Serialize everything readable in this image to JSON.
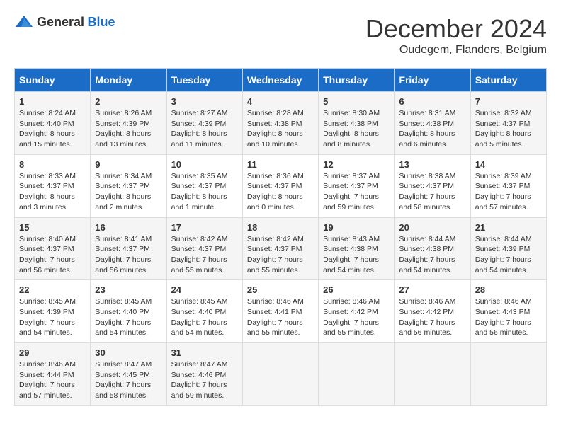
{
  "header": {
    "logo_general": "General",
    "logo_blue": "Blue",
    "month_title": "December 2024",
    "location": "Oudegem, Flanders, Belgium"
  },
  "days_of_week": [
    "Sunday",
    "Monday",
    "Tuesday",
    "Wednesday",
    "Thursday",
    "Friday",
    "Saturday"
  ],
  "weeks": [
    [
      {
        "day": "1",
        "sunrise": "8:24 AM",
        "sunset": "4:40 PM",
        "daylight": "8 hours and 15 minutes."
      },
      {
        "day": "2",
        "sunrise": "8:26 AM",
        "sunset": "4:39 PM",
        "daylight": "8 hours and 13 minutes."
      },
      {
        "day": "3",
        "sunrise": "8:27 AM",
        "sunset": "4:39 PM",
        "daylight": "8 hours and 11 minutes."
      },
      {
        "day": "4",
        "sunrise": "8:28 AM",
        "sunset": "4:38 PM",
        "daylight": "8 hours and 10 minutes."
      },
      {
        "day": "5",
        "sunrise": "8:30 AM",
        "sunset": "4:38 PM",
        "daylight": "8 hours and 8 minutes."
      },
      {
        "day": "6",
        "sunrise": "8:31 AM",
        "sunset": "4:38 PM",
        "daylight": "8 hours and 6 minutes."
      },
      {
        "day": "7",
        "sunrise": "8:32 AM",
        "sunset": "4:37 PM",
        "daylight": "8 hours and 5 minutes."
      }
    ],
    [
      {
        "day": "8",
        "sunrise": "8:33 AM",
        "sunset": "4:37 PM",
        "daylight": "8 hours and 3 minutes."
      },
      {
        "day": "9",
        "sunrise": "8:34 AM",
        "sunset": "4:37 PM",
        "daylight": "8 hours and 2 minutes."
      },
      {
        "day": "10",
        "sunrise": "8:35 AM",
        "sunset": "4:37 PM",
        "daylight": "8 hours and 1 minute."
      },
      {
        "day": "11",
        "sunrise": "8:36 AM",
        "sunset": "4:37 PM",
        "daylight": "8 hours and 0 minutes."
      },
      {
        "day": "12",
        "sunrise": "8:37 AM",
        "sunset": "4:37 PM",
        "daylight": "7 hours and 59 minutes."
      },
      {
        "day": "13",
        "sunrise": "8:38 AM",
        "sunset": "4:37 PM",
        "daylight": "7 hours and 58 minutes."
      },
      {
        "day": "14",
        "sunrise": "8:39 AM",
        "sunset": "4:37 PM",
        "daylight": "7 hours and 57 minutes."
      }
    ],
    [
      {
        "day": "15",
        "sunrise": "8:40 AM",
        "sunset": "4:37 PM",
        "daylight": "7 hours and 56 minutes."
      },
      {
        "day": "16",
        "sunrise": "8:41 AM",
        "sunset": "4:37 PM",
        "daylight": "7 hours and 56 minutes."
      },
      {
        "day": "17",
        "sunrise": "8:42 AM",
        "sunset": "4:37 PM",
        "daylight": "7 hours and 55 minutes."
      },
      {
        "day": "18",
        "sunrise": "8:42 AM",
        "sunset": "4:37 PM",
        "daylight": "7 hours and 55 minutes."
      },
      {
        "day": "19",
        "sunrise": "8:43 AM",
        "sunset": "4:38 PM",
        "daylight": "7 hours and 54 minutes."
      },
      {
        "day": "20",
        "sunrise": "8:44 AM",
        "sunset": "4:38 PM",
        "daylight": "7 hours and 54 minutes."
      },
      {
        "day": "21",
        "sunrise": "8:44 AM",
        "sunset": "4:39 PM",
        "daylight": "7 hours and 54 minutes."
      }
    ],
    [
      {
        "day": "22",
        "sunrise": "8:45 AM",
        "sunset": "4:39 PM",
        "daylight": "7 hours and 54 minutes."
      },
      {
        "day": "23",
        "sunrise": "8:45 AM",
        "sunset": "4:40 PM",
        "daylight": "7 hours and 54 minutes."
      },
      {
        "day": "24",
        "sunrise": "8:45 AM",
        "sunset": "4:40 PM",
        "daylight": "7 hours and 54 minutes."
      },
      {
        "day": "25",
        "sunrise": "8:46 AM",
        "sunset": "4:41 PM",
        "daylight": "7 hours and 55 minutes."
      },
      {
        "day": "26",
        "sunrise": "8:46 AM",
        "sunset": "4:42 PM",
        "daylight": "7 hours and 55 minutes."
      },
      {
        "day": "27",
        "sunrise": "8:46 AM",
        "sunset": "4:42 PM",
        "daylight": "7 hours and 56 minutes."
      },
      {
        "day": "28",
        "sunrise": "8:46 AM",
        "sunset": "4:43 PM",
        "daylight": "7 hours and 56 minutes."
      }
    ],
    [
      {
        "day": "29",
        "sunrise": "8:46 AM",
        "sunset": "4:44 PM",
        "daylight": "7 hours and 57 minutes."
      },
      {
        "day": "30",
        "sunrise": "8:47 AM",
        "sunset": "4:45 PM",
        "daylight": "7 hours and 58 minutes."
      },
      {
        "day": "31",
        "sunrise": "8:47 AM",
        "sunset": "4:46 PM",
        "daylight": "7 hours and 59 minutes."
      },
      null,
      null,
      null,
      null
    ]
  ]
}
